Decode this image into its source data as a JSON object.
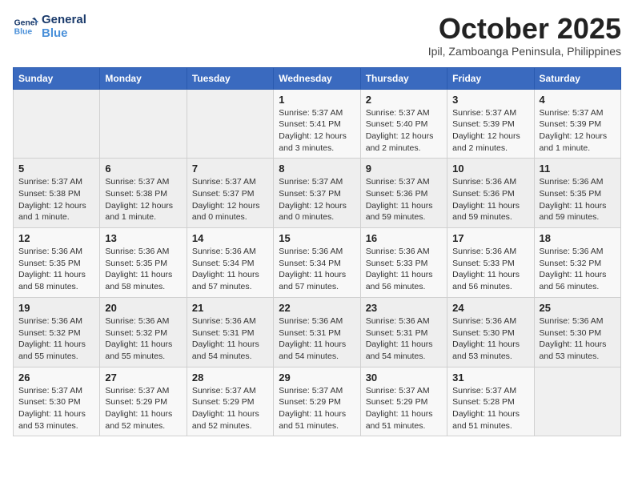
{
  "logo": {
    "line1": "General",
    "line2": "Blue"
  },
  "title": "October 2025",
  "subtitle": "Ipil, Zamboanga Peninsula, Philippines",
  "days_of_week": [
    "Sunday",
    "Monday",
    "Tuesday",
    "Wednesday",
    "Thursday",
    "Friday",
    "Saturday"
  ],
  "weeks": [
    [
      {
        "day": "",
        "info": ""
      },
      {
        "day": "",
        "info": ""
      },
      {
        "day": "",
        "info": ""
      },
      {
        "day": "1",
        "info": "Sunrise: 5:37 AM\nSunset: 5:41 PM\nDaylight: 12 hours and 3 minutes."
      },
      {
        "day": "2",
        "info": "Sunrise: 5:37 AM\nSunset: 5:40 PM\nDaylight: 12 hours and 2 minutes."
      },
      {
        "day": "3",
        "info": "Sunrise: 5:37 AM\nSunset: 5:39 PM\nDaylight: 12 hours and 2 minutes."
      },
      {
        "day": "4",
        "info": "Sunrise: 5:37 AM\nSunset: 5:39 PM\nDaylight: 12 hours and 1 minute."
      }
    ],
    [
      {
        "day": "5",
        "info": "Sunrise: 5:37 AM\nSunset: 5:38 PM\nDaylight: 12 hours and 1 minute."
      },
      {
        "day": "6",
        "info": "Sunrise: 5:37 AM\nSunset: 5:38 PM\nDaylight: 12 hours and 1 minute."
      },
      {
        "day": "7",
        "info": "Sunrise: 5:37 AM\nSunset: 5:37 PM\nDaylight: 12 hours and 0 minutes."
      },
      {
        "day": "8",
        "info": "Sunrise: 5:37 AM\nSunset: 5:37 PM\nDaylight: 12 hours and 0 minutes."
      },
      {
        "day": "9",
        "info": "Sunrise: 5:37 AM\nSunset: 5:36 PM\nDaylight: 11 hours and 59 minutes."
      },
      {
        "day": "10",
        "info": "Sunrise: 5:36 AM\nSunset: 5:36 PM\nDaylight: 11 hours and 59 minutes."
      },
      {
        "day": "11",
        "info": "Sunrise: 5:36 AM\nSunset: 5:35 PM\nDaylight: 11 hours and 59 minutes."
      }
    ],
    [
      {
        "day": "12",
        "info": "Sunrise: 5:36 AM\nSunset: 5:35 PM\nDaylight: 11 hours and 58 minutes."
      },
      {
        "day": "13",
        "info": "Sunrise: 5:36 AM\nSunset: 5:35 PM\nDaylight: 11 hours and 58 minutes."
      },
      {
        "day": "14",
        "info": "Sunrise: 5:36 AM\nSunset: 5:34 PM\nDaylight: 11 hours and 57 minutes."
      },
      {
        "day": "15",
        "info": "Sunrise: 5:36 AM\nSunset: 5:34 PM\nDaylight: 11 hours and 57 minutes."
      },
      {
        "day": "16",
        "info": "Sunrise: 5:36 AM\nSunset: 5:33 PM\nDaylight: 11 hours and 56 minutes."
      },
      {
        "day": "17",
        "info": "Sunrise: 5:36 AM\nSunset: 5:33 PM\nDaylight: 11 hours and 56 minutes."
      },
      {
        "day": "18",
        "info": "Sunrise: 5:36 AM\nSunset: 5:32 PM\nDaylight: 11 hours and 56 minutes."
      }
    ],
    [
      {
        "day": "19",
        "info": "Sunrise: 5:36 AM\nSunset: 5:32 PM\nDaylight: 11 hours and 55 minutes."
      },
      {
        "day": "20",
        "info": "Sunrise: 5:36 AM\nSunset: 5:32 PM\nDaylight: 11 hours and 55 minutes."
      },
      {
        "day": "21",
        "info": "Sunrise: 5:36 AM\nSunset: 5:31 PM\nDaylight: 11 hours and 54 minutes."
      },
      {
        "day": "22",
        "info": "Sunrise: 5:36 AM\nSunset: 5:31 PM\nDaylight: 11 hours and 54 minutes."
      },
      {
        "day": "23",
        "info": "Sunrise: 5:36 AM\nSunset: 5:31 PM\nDaylight: 11 hours and 54 minutes."
      },
      {
        "day": "24",
        "info": "Sunrise: 5:36 AM\nSunset: 5:30 PM\nDaylight: 11 hours and 53 minutes."
      },
      {
        "day": "25",
        "info": "Sunrise: 5:36 AM\nSunset: 5:30 PM\nDaylight: 11 hours and 53 minutes."
      }
    ],
    [
      {
        "day": "26",
        "info": "Sunrise: 5:37 AM\nSunset: 5:30 PM\nDaylight: 11 hours and 53 minutes."
      },
      {
        "day": "27",
        "info": "Sunrise: 5:37 AM\nSunset: 5:29 PM\nDaylight: 11 hours and 52 minutes."
      },
      {
        "day": "28",
        "info": "Sunrise: 5:37 AM\nSunset: 5:29 PM\nDaylight: 11 hours and 52 minutes."
      },
      {
        "day": "29",
        "info": "Sunrise: 5:37 AM\nSunset: 5:29 PM\nDaylight: 11 hours and 51 minutes."
      },
      {
        "day": "30",
        "info": "Sunrise: 5:37 AM\nSunset: 5:29 PM\nDaylight: 11 hours and 51 minutes."
      },
      {
        "day": "31",
        "info": "Sunrise: 5:37 AM\nSunset: 5:28 PM\nDaylight: 11 hours and 51 minutes."
      },
      {
        "day": "",
        "info": ""
      }
    ]
  ]
}
